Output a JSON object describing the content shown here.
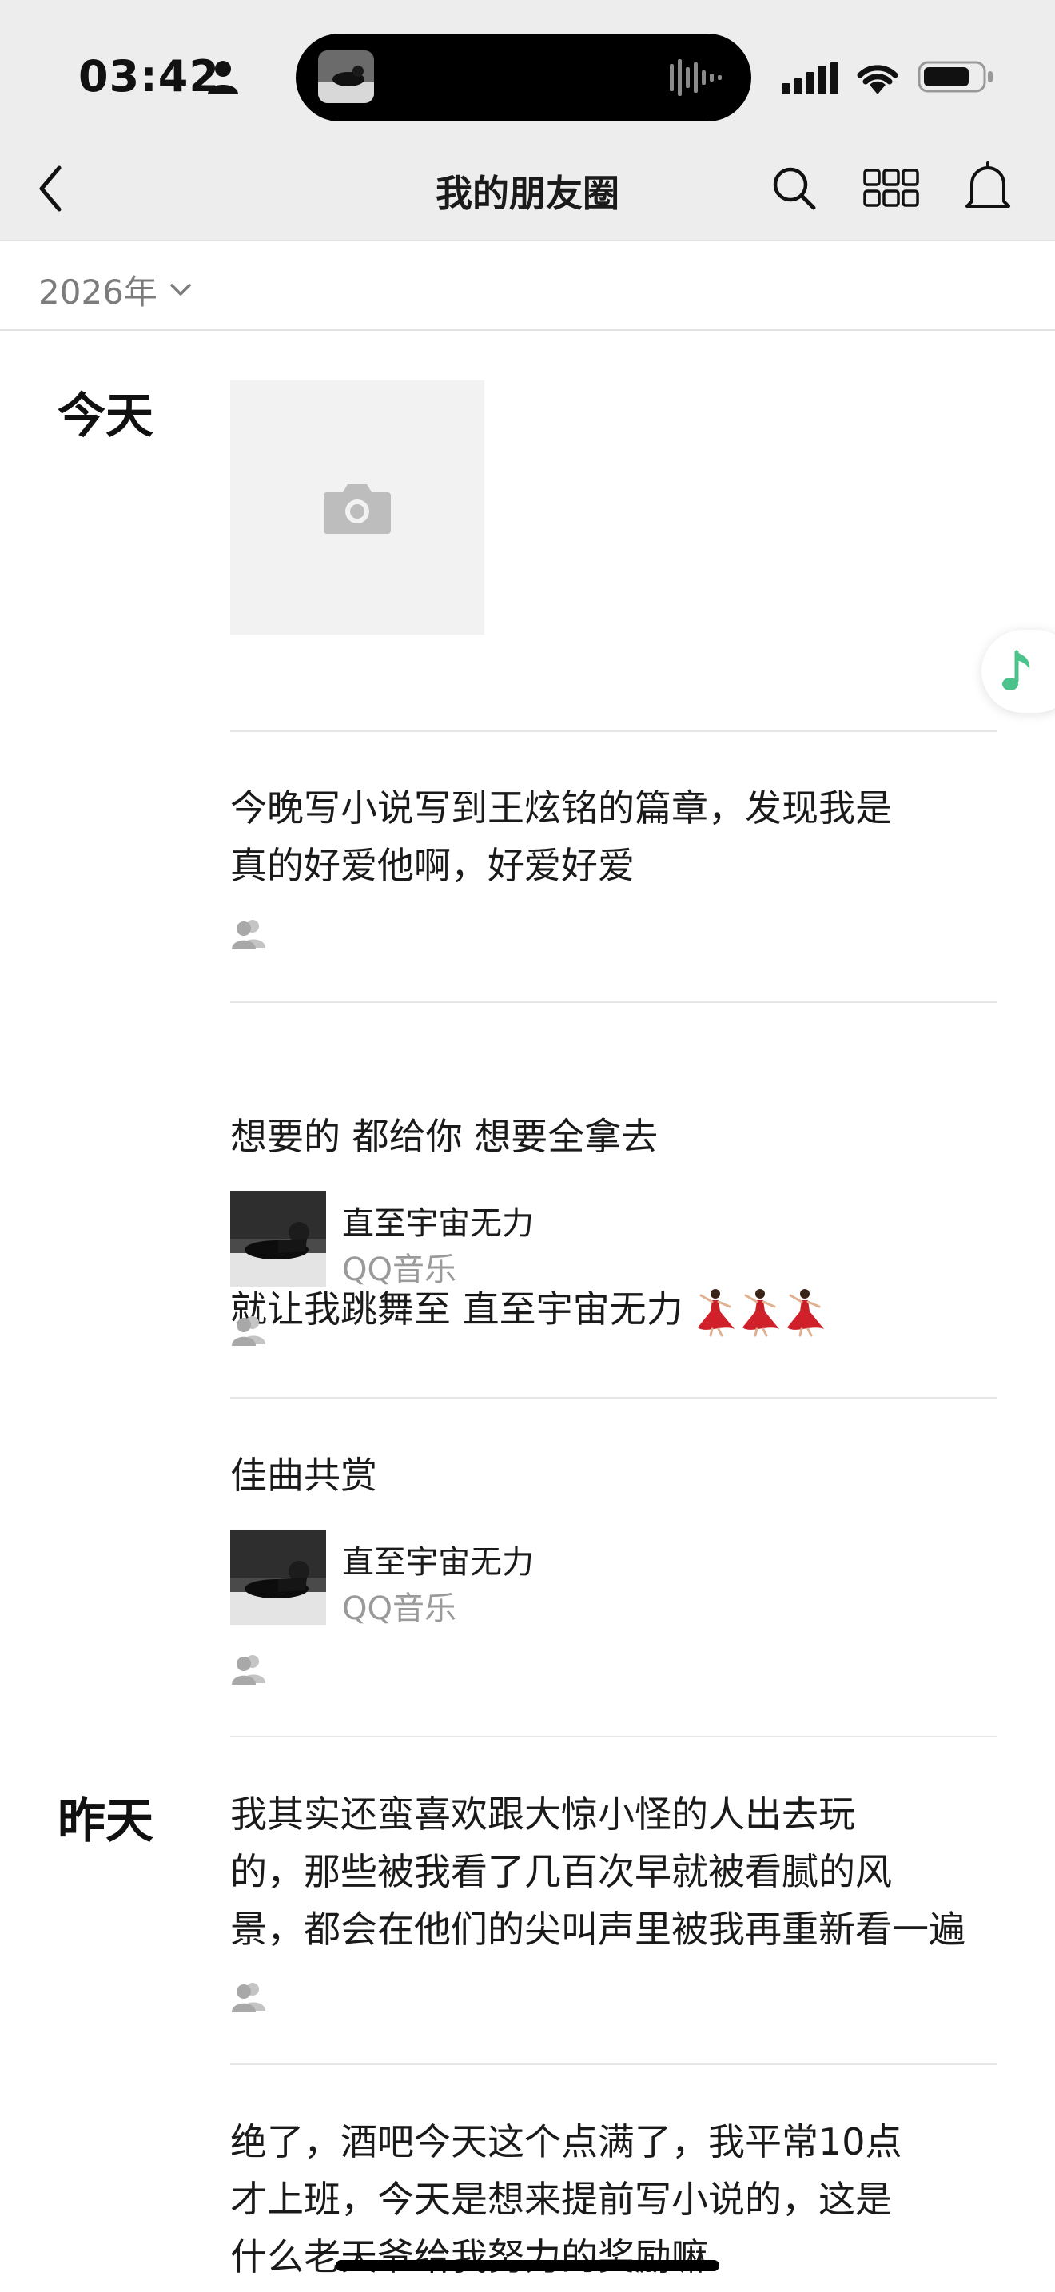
{
  "status_bar": {
    "time": "03:42"
  },
  "nav": {
    "title": "我的朋友圈"
  },
  "year_filter": {
    "label": "2026年"
  },
  "days": [
    {
      "label": "今天"
    },
    {
      "label": "昨天"
    }
  ],
  "posts": [
    {
      "text": "今晚写小说写到王炫铭的篇章，发现我是\n真的好爱他啊，好爱好爱"
    },
    {
      "text_line1": "想要的 都给你 想要全拿去",
      "text_line2": "就让我跳舞至 直至宇宙无力",
      "emoji": [
        "dancer-icon",
        "dancer-icon",
        "dancer-icon"
      ],
      "music": {
        "title": "直至宇宙无力",
        "source": "QQ音乐"
      }
    },
    {
      "text": "佳曲共赏",
      "music": {
        "title": "直至宇宙无力",
        "source": "QQ音乐"
      }
    },
    {
      "text": "我其实还蛮喜欢跟大惊小怪的人出去玩\n的，那些被我看了几百次早就被看腻的风\n景，都会在他们的尖叫声里被我再重新看一遍"
    },
    {
      "text": "绝了，酒吧今天这个点满了，我平常10点\n才上班，今天是想来提前写小说的，这是\n什么老天爷给我努力的奖励嘛"
    }
  ],
  "colors": {
    "header_bg": "#ededed",
    "accent_green": "#4cc38a",
    "dancer_red": "#d0202a"
  }
}
